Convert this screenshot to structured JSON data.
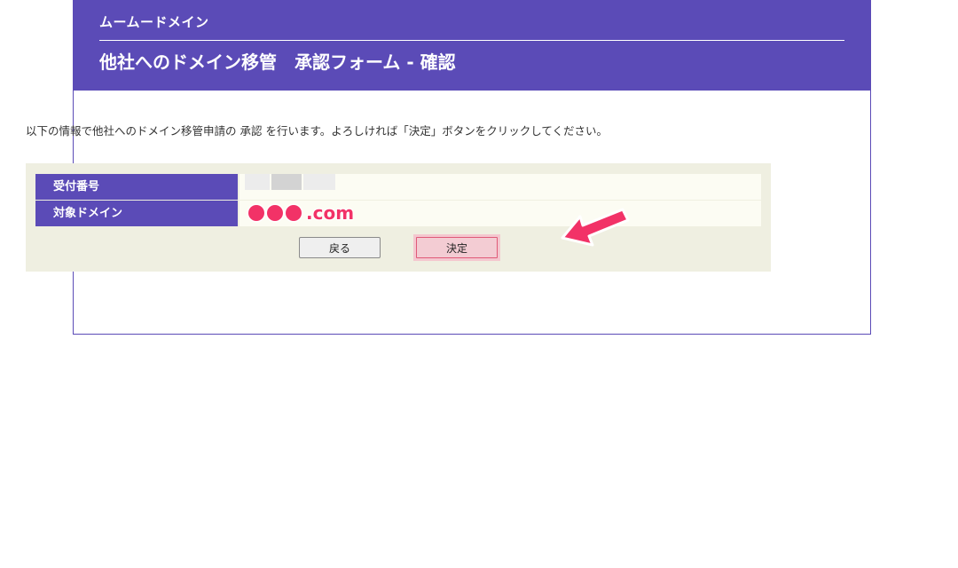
{
  "header": {
    "brand": "ムームードメイン",
    "title": "他社へのドメイン移管　承認フォーム - 確認"
  },
  "intro": {
    "text": "以下の情報で他社へのドメイン移管申請の 承認 を行います。よろしければ「決定」ボタンをクリックしてください。"
  },
  "table": {
    "rows": [
      {
        "label": "受付番号",
        "value": ""
      },
      {
        "label": "対象ドメイン",
        "value": ".com"
      }
    ]
  },
  "buttons": {
    "back_label": "戻る",
    "decide_label": "決定"
  },
  "colors": {
    "header_bg": "#5b4bb7",
    "panel_bg": "#efefe1",
    "accent_pink": "#f23267",
    "decide_bg": "#f3ccd3"
  },
  "icons": {
    "pointer": "arrow-pointer-icon"
  }
}
